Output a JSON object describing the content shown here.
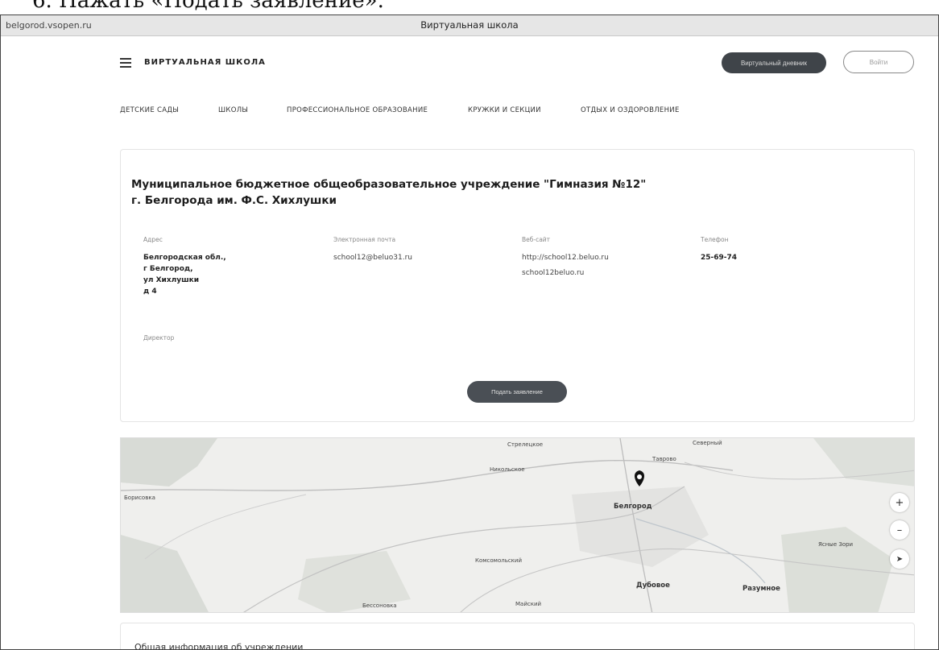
{
  "doc_heading": "6.   Нажать «Подать заявление».",
  "window": {
    "url": "belgorod.vsopen.ru",
    "title": "Виртуальная школа"
  },
  "header": {
    "brand": "ВИРТУАЛЬНАЯ ШКОЛА",
    "dark_button": "Виртуальный дневник",
    "login_button": "Войти"
  },
  "nav": {
    "categories": [
      "ДЕТСКИЕ САДЫ",
      "ШКОЛЫ",
      "ПРОФЕССИОНАЛЬНОЕ ОБРАЗОВАНИЕ",
      "КРУЖКИ И СЕКЦИИ",
      "ОТДЫХ И ОЗДОРОВЛЕНИЕ"
    ]
  },
  "school": {
    "name": "Муниципальное бюджетное общеобразовательное учреждение \"Гимназия №12\" г. Белгорода им. Ф.С. Хихлушки",
    "address_label": "Адрес",
    "address_lines": [
      "Белгородская обл.,",
      "г Белгород,",
      "ул Хихлушки",
      "д 4"
    ],
    "email_label": "Электронная почта",
    "email": "school12@beluo31.ru",
    "website_label": "Веб-сайт",
    "website_lines": [
      "http://school12.beluo.ru",
      "school12beluo.ru"
    ],
    "phone_label": "Телефон",
    "phone": "25-69-74",
    "director_label": "Директор",
    "submit_button": "Подать заявление"
  },
  "map": {
    "labels": [
      "Стрелецкое",
      "Борисовка",
      "Белгород",
      "Дубовое",
      "Разумное",
      "Майский",
      "Никольское",
      "Таврово",
      "Северный",
      "Комсомольский",
      "Бессоновка",
      "Ясные Зори"
    ],
    "zoom_in": "+",
    "zoom_out": "–",
    "locate": "➤"
  },
  "info_section": {
    "title": "Общая информация об учреждении"
  }
}
